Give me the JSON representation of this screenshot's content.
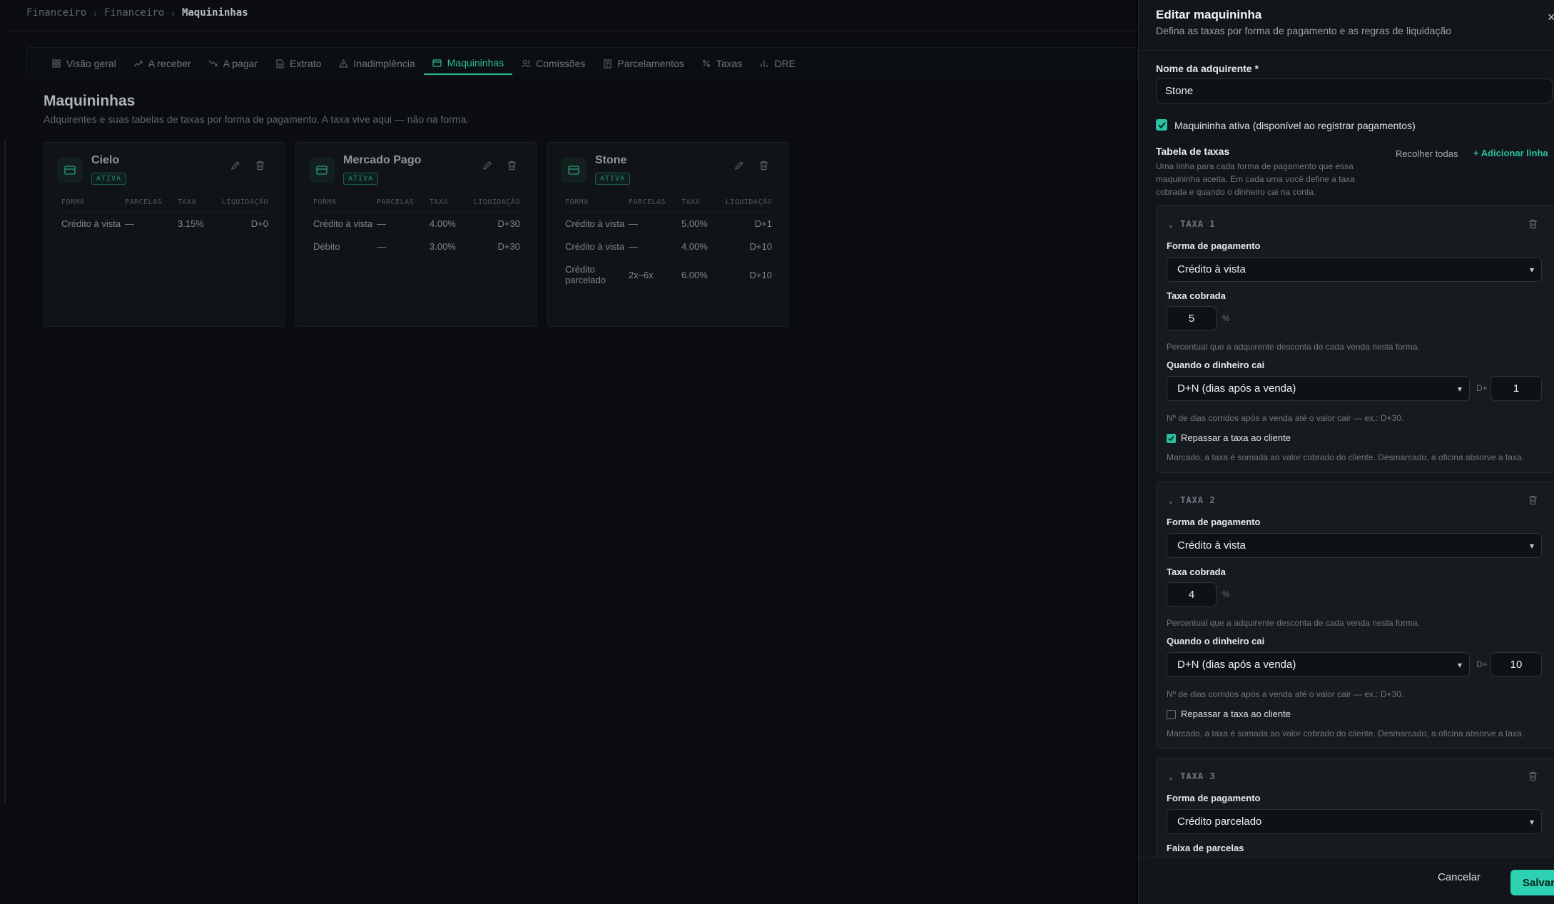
{
  "breadcrumb": [
    "Financeiro",
    "Financeiro",
    "Maquininhas"
  ],
  "tabs": [
    {
      "label": "Visão geral",
      "icon": "grid-icon",
      "active": false
    },
    {
      "label": "A receber",
      "icon": "trend-up-icon",
      "active": false
    },
    {
      "label": "A pagar",
      "icon": "trend-down-icon",
      "active": false
    },
    {
      "label": "Extrato",
      "icon": "document-icon",
      "active": false
    },
    {
      "label": "Inadimplência",
      "icon": "warning-icon",
      "active": false
    },
    {
      "label": "Maquininhas",
      "icon": "card-icon",
      "active": true
    },
    {
      "label": "Comissões",
      "icon": "users-icon",
      "active": false
    },
    {
      "label": "Parcelamentos",
      "icon": "receipt-icon",
      "active": false
    },
    {
      "label": "Taxas",
      "icon": "percent-icon",
      "active": false
    },
    {
      "label": "DRE",
      "icon": "bar-chart-icon",
      "active": false
    }
  ],
  "page": {
    "title": "Maquininhas",
    "subtitle": "Adquirentes e suas tabelas de taxas por forma de pagamento. A taxa vive aqui — não na forma."
  },
  "table_headers": [
    "FORMA",
    "PARCELAS",
    "TAXA",
    "LIQUIDAÇÃO"
  ],
  "cards": [
    {
      "name": "Cielo",
      "status": "ATIVA",
      "rows": [
        {
          "forma": "Crédito à vista",
          "parcelas": "—",
          "taxa": "3.15%",
          "liquidacao": "D+0"
        }
      ]
    },
    {
      "name": "Mercado Pago",
      "status": "ATIVA",
      "rows": [
        {
          "forma": "Crédito à vista",
          "parcelas": "—",
          "taxa": "4.00%",
          "liquidacao": "D+30"
        },
        {
          "forma": "Débito",
          "parcelas": "—",
          "taxa": "3.00%",
          "liquidacao": "D+30"
        }
      ]
    },
    {
      "name": "Stone",
      "status": "ATIVA",
      "rows": [
        {
          "forma": "Crédito à vista",
          "parcelas": "—",
          "taxa": "5.00%",
          "liquidacao": "D+1"
        },
        {
          "forma": "Crédito à vista",
          "parcelas": "—",
          "taxa": "4.00%",
          "liquidacao": "D+10"
        },
        {
          "forma": "Crédito parcelado",
          "parcelas": "2x–6x",
          "taxa": "6.00%",
          "liquidacao": "D+10"
        }
      ]
    }
  ],
  "drawer": {
    "title": "Editar maquininha",
    "subtitle": "Defina as taxas por forma de pagamento e as regras de liquidação",
    "close": "×",
    "name_label": "Nome da adquirente *",
    "name_value": "Stone",
    "active_label": "Maquininha ativa (disponível ao registrar pagamentos)",
    "active_checked": true,
    "section_title": "Tabela de taxas",
    "section_desc": "Uma linha para cada forma de pagamento que essa maquininha aceita. Em cada uma você define a taxa cobrada e quando o dinheiro cai na conta.",
    "collapse_all": "Recolher todas",
    "add_row": "+ Adicionar linha",
    "field_labels": {
      "forma": "Forma de pagamento",
      "taxa": "Taxa cobrada",
      "taxa_hint": "Percentual que a adquirente desconta de cada venda nesta forma.",
      "quando": "Quando o dinheiro cai",
      "dias_hint": "Nº de dias corridos após a venda até o valor cair — ex.: D+30.",
      "repassar": "Repassar a taxa ao cliente",
      "repassar_hint": "Marcado, a taxa é somada ao valor cobrado do cliente. Desmarcado, a oficina absorve a taxa.",
      "faixa": "Faixa de parcelas",
      "percent": "%",
      "dplus": "D+"
    },
    "taxas": [
      {
        "header": "TAXA 1",
        "forma": "Crédito à vista",
        "taxa": "5",
        "quando": "D+N (dias após a venda)",
        "dias": "1",
        "repassar": true
      },
      {
        "header": "TAXA 2",
        "forma": "Crédito à vista",
        "taxa": "4",
        "quando": "D+N (dias após a venda)",
        "dias": "10",
        "repassar": false
      },
      {
        "header": "TAXA 3",
        "forma": "Crédito parcelado"
      }
    ],
    "cancel": "Cancelar",
    "save": "Salvar"
  },
  "colors": {
    "accent": "#2bc1a0",
    "background": "#0b0d10",
    "drawer": "#12161a"
  }
}
